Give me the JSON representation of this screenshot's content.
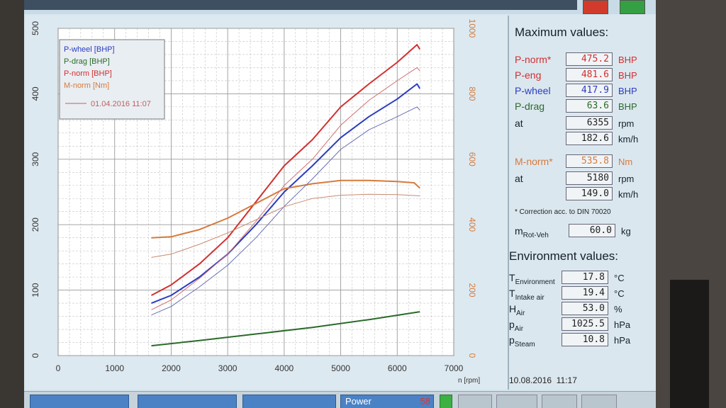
{
  "legend": {
    "items": [
      {
        "label": "P-wheel [BHP]",
        "color": "#2b3cc0"
      },
      {
        "label": "P-drag [BHP]",
        "color": "#2a6b2a"
      },
      {
        "label": "P-norm [BHP]",
        "color": "#d13030"
      },
      {
        "label": "M-norm [Nm]",
        "color": "#d67a3c"
      }
    ],
    "reference": {
      "label": "01.04.2016 11:07",
      "color": "#c06060"
    }
  },
  "chart_data": {
    "type": "line",
    "xlabel": "n [rpm]",
    "xlim": [
      0,
      7000
    ],
    "x_ticks": [
      "0",
      "1000",
      "2000",
      "3000",
      "4000",
      "5000",
      "6000",
      "7000"
    ],
    "ylim_left": [
      0,
      500
    ],
    "y_left_ticks": [
      "0",
      "100",
      "200",
      "300",
      "400",
      "500"
    ],
    "ylim_right": [
      0,
      1000
    ],
    "y_right_ticks": [
      "0",
      "200",
      "400",
      "600",
      "800",
      "1000"
    ],
    "grid": true,
    "series": [
      {
        "name": "P-norm [BHP]",
        "axis": "left",
        "color": "#d13030",
        "width": 2,
        "x": [
          1650,
          2000,
          2500,
          3000,
          3500,
          4000,
          4500,
          5000,
          5500,
          6000,
          6350,
          6400
        ],
        "y": [
          92,
          108,
          140,
          180,
          235,
          290,
          330,
          380,
          415,
          448,
          475,
          468
        ]
      },
      {
        "name": "P-wheel [BHP]",
        "axis": "left",
        "color": "#2b3cc0",
        "width": 2,
        "x": [
          1650,
          2000,
          2500,
          3000,
          3500,
          4000,
          4500,
          5000,
          5500,
          6000,
          6350,
          6400
        ],
        "y": [
          80,
          92,
          120,
          155,
          200,
          250,
          290,
          333,
          365,
          392,
          415,
          408
        ]
      },
      {
        "name": "P-drag [BHP]",
        "axis": "left",
        "color": "#2a6b2a",
        "width": 2,
        "x": [
          1650,
          2500,
          3500,
          4500,
          5500,
          6400
        ],
        "y": [
          15,
          23,
          33,
          43,
          55,
          67
        ]
      },
      {
        "name": "M-norm [Nm]",
        "axis": "right",
        "color": "#d67a3c",
        "width": 2,
        "x": [
          1650,
          2000,
          2500,
          3000,
          3500,
          4000,
          4500,
          5000,
          5500,
          6000,
          6300,
          6400
        ],
        "y": [
          360,
          363,
          385,
          420,
          465,
          510,
          525,
          535,
          535,
          532,
          528,
          512
        ]
      },
      {
        "name": "P-norm ref",
        "axis": "left",
        "color": "#d07070",
        "width": 1,
        "x": [
          1650,
          2000,
          2500,
          3000,
          3500,
          4000,
          4500,
          5000,
          5500,
          6000,
          6350,
          6400
        ],
        "y": [
          70,
          85,
          118,
          155,
          205,
          260,
          300,
          352,
          390,
          420,
          440,
          435
        ]
      },
      {
        "name": "P-wheel ref",
        "axis": "left",
        "color": "#6a6fb0",
        "width": 1,
        "x": [
          1650,
          2000,
          2500,
          3000,
          3500,
          4000,
          4500,
          5000,
          5500,
          6000,
          6350,
          6400
        ],
        "y": [
          62,
          75,
          105,
          138,
          180,
          228,
          270,
          315,
          345,
          365,
          380,
          375
        ]
      },
      {
        "name": "M-norm ref",
        "axis": "right",
        "color": "#c98a70",
        "width": 1,
        "x": [
          1650,
          2000,
          2500,
          3000,
          3500,
          4000,
          4500,
          5000,
          5500,
          6000,
          6400
        ],
        "y": [
          300,
          310,
          340,
          375,
          415,
          455,
          480,
          490,
          493,
          492,
          488
        ]
      }
    ]
  },
  "max_values": {
    "title": "Maximum values:",
    "rows": [
      {
        "label": "P-norm*",
        "value": "475.2",
        "unit": "BHP",
        "color": "#d13030"
      },
      {
        "label": "P-eng",
        "value": "481.6",
        "unit": "BHP",
        "color": "#d13030"
      },
      {
        "label": "P-wheel",
        "value": "417.9",
        "unit": "BHP",
        "color": "#2b3cc0"
      },
      {
        "label": "P-drag",
        "value": "63.6",
        "unit": "BHP",
        "color": "#2a6b2a"
      },
      {
        "label": "at",
        "value": "6355",
        "unit": "rpm",
        "color": "#15202a"
      },
      {
        "label": "",
        "value": "182.6",
        "unit": "km/h",
        "color": "#15202a"
      },
      {
        "label": "M-norm*",
        "value": "535.8",
        "unit": "Nm",
        "color": "#d67a3c"
      },
      {
        "label": "at",
        "value": "5180",
        "unit": "rpm",
        "color": "#15202a"
      },
      {
        "label": "",
        "value": "149.0",
        "unit": "km/h",
        "color": "#15202a"
      }
    ],
    "note": "* Correction acc. to DIN 70020",
    "mass": {
      "label": "m",
      "sub": "Rot-Veh",
      "value": "60.0",
      "unit": "kg"
    }
  },
  "environment": {
    "title": "Environment values:",
    "rows": [
      {
        "label": "T",
        "sub": "Environment",
        "value": "17.8",
        "unit": "°C"
      },
      {
        "label": "T",
        "sub": "Intake air",
        "value": "19.4",
        "unit": "°C"
      },
      {
        "label": "H",
        "sub": "Air",
        "value": "53.0",
        "unit": "%"
      },
      {
        "label": "p",
        "sub": "Air",
        "value": "1025.5",
        "unit": "hPa"
      },
      {
        "label": "p",
        "sub": "Steam",
        "value": "10.8",
        "unit": "hPa"
      }
    ]
  },
  "datetime": "10.08.2016  11:17",
  "bottom_bar": {
    "buttons": [
      {
        "label": "Power",
        "num": "58"
      }
    ]
  }
}
